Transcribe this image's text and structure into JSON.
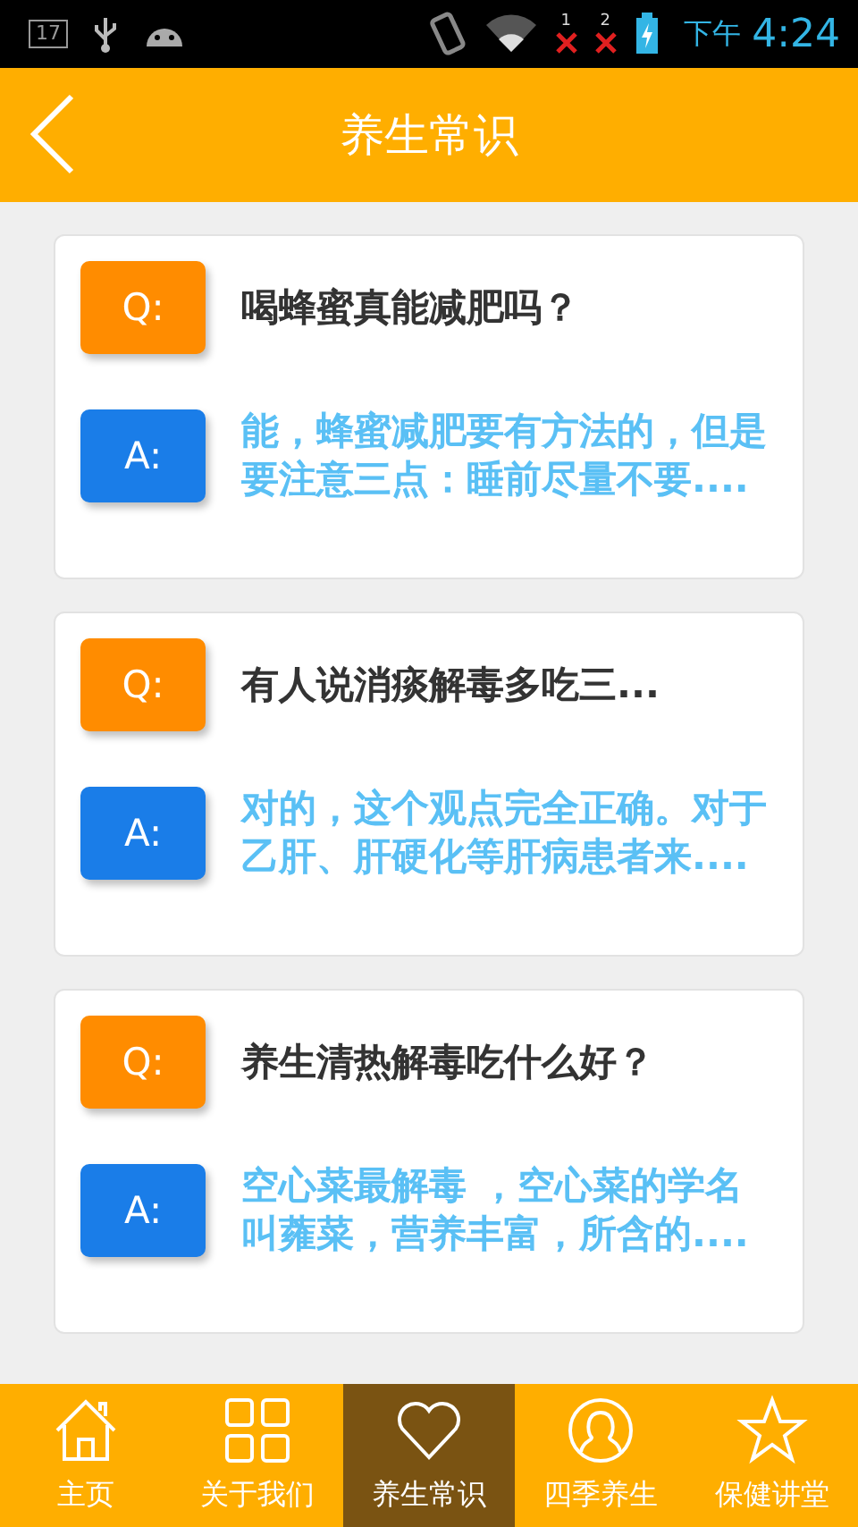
{
  "status_bar": {
    "calendar_day": "17",
    "sim_slots": [
      "1",
      "2"
    ],
    "period": "下午",
    "time": "4:24"
  },
  "header": {
    "title": "养生常识"
  },
  "qa_items": [
    {
      "q_label": "Q:",
      "question": "喝蜂蜜真能减肥吗？",
      "a_label": "A:",
      "answer": "能，蜂蜜减肥要有方法的，但是要注意三点：睡前尽量不要...."
    },
    {
      "q_label": "Q:",
      "question": "有人说消痰解毒多吃三...",
      "a_label": "A:",
      "answer": "对的，这个观点完全正确。对于乙肝、肝硬化等肝病患者来...."
    },
    {
      "q_label": "Q:",
      "question": "养生清热解毒吃什么好？",
      "a_label": "A:",
      "answer": "空心菜最解毒 ，空心菜的学名叫蕹菜，营养丰富，所含的...."
    }
  ],
  "tabs": [
    {
      "kind": "home",
      "label": "主页",
      "selected": false
    },
    {
      "kind": "grid",
      "label": "关于我们",
      "selected": false
    },
    {
      "kind": "heart",
      "label": "养生常识",
      "selected": true
    },
    {
      "kind": "person",
      "label": "四季养生",
      "selected": false
    },
    {
      "kind": "star",
      "label": "保健讲堂",
      "selected": false
    }
  ]
}
